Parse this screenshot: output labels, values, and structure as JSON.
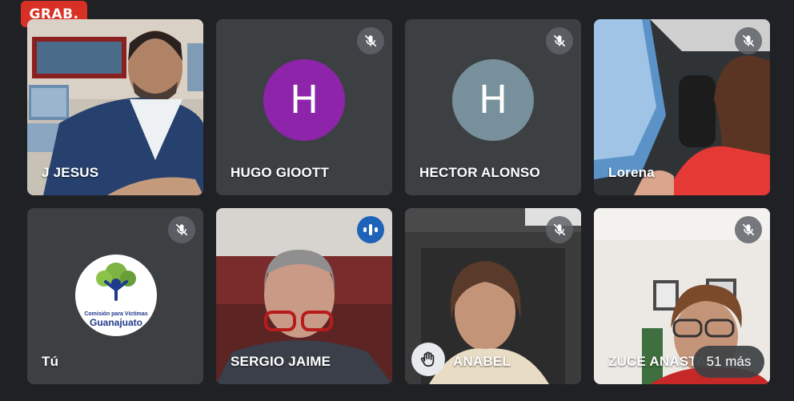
{
  "recording": {
    "label": "GRAB."
  },
  "participants": [
    {
      "name": "J JESUS",
      "muted": false
    },
    {
      "name": "HUGO GIOOTT",
      "initial": "H",
      "avatar_color": "#8e24aa",
      "muted": true
    },
    {
      "name": "HECTOR ALONSO",
      "initial": "H",
      "avatar_color": "#78909c",
      "muted": true
    },
    {
      "name": "Lorena",
      "muted": true
    },
    {
      "name": "Tú",
      "muted": true,
      "logo_line1": "Comisión para Víctimas",
      "logo_line2": "Guanajuato"
    },
    {
      "name": "SERGIO JAIME",
      "speaking": true
    },
    {
      "name": "ANABEL",
      "muted": true,
      "hand_raised": true
    },
    {
      "name": "ZUCE ANASTA",
      "muted": true
    }
  ],
  "more": {
    "label": "51 más"
  },
  "colors": {
    "record": "#d93025",
    "speaking": "#1f63b8",
    "tile_bg": "#3c4043"
  }
}
